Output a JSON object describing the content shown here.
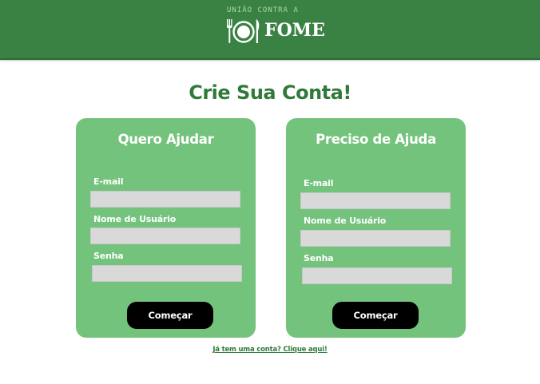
{
  "header": {
    "logo_top": "UNIÃO CONTRA A",
    "logo_word": "FOME",
    "logo_icon": "plate-fork-knife-icon"
  },
  "page_title": "Crie Sua Conta!",
  "cards": [
    {
      "title": "Quero Ajudar",
      "email_label": "E-mail",
      "email_value": "",
      "username_label": "Nome de Usuário",
      "username_value": "",
      "password_label": "Senha",
      "password_value": "",
      "button_label": "Começar"
    },
    {
      "title": "Preciso de Ajuda",
      "email_label": "E-mail",
      "email_value": "",
      "username_label": "Nome de Usuário",
      "username_value": "",
      "password_label": "Senha",
      "password_value": "",
      "button_label": "Começar"
    }
  ],
  "login_link": "Já tem uma conta? Clique aqui!",
  "colors": {
    "header_green": "#3a8243",
    "card_green": "#73c37d",
    "title_green": "#2f7a39",
    "input_gray": "#d9d9d9",
    "button_black": "#000000"
  }
}
